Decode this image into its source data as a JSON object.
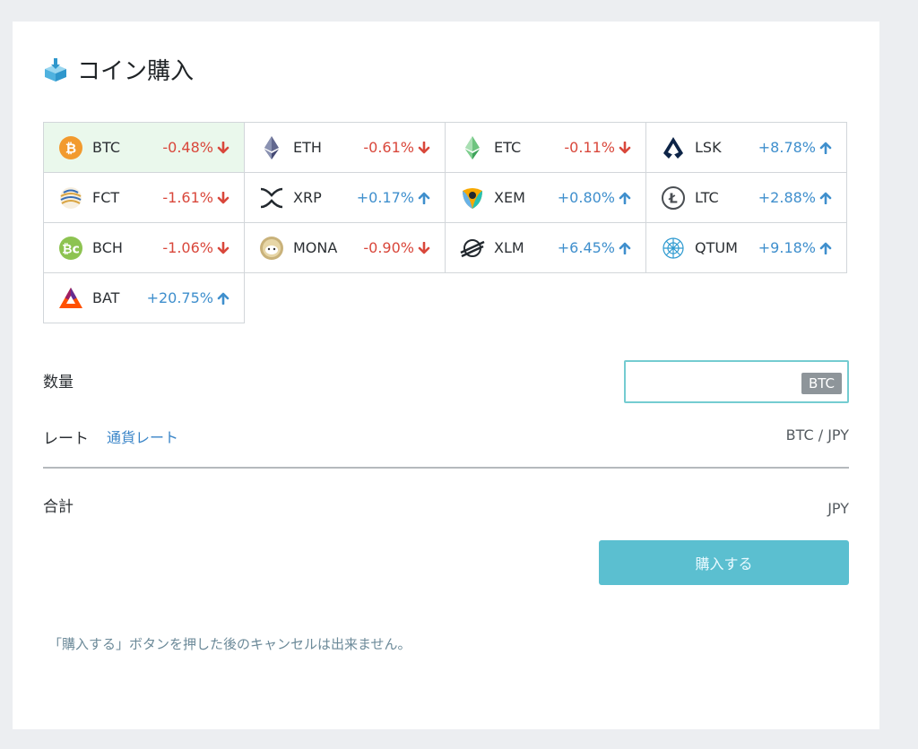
{
  "page": {
    "title": "コイン購入"
  },
  "coins": [
    [
      {
        "symbol": "BTC",
        "change": "-0.48%",
        "direction": "down",
        "icon": "bitcoin-icon",
        "selected": true
      },
      {
        "symbol": "ETH",
        "change": "-0.61%",
        "direction": "down",
        "icon": "ethereum-icon"
      },
      {
        "symbol": "ETC",
        "change": "-0.11%",
        "direction": "down",
        "icon": "ethereum-classic-icon"
      },
      {
        "symbol": "LSK",
        "change": "+8.78%",
        "direction": "up",
        "icon": "lisk-icon"
      }
    ],
    [
      {
        "symbol": "FCT",
        "change": "-1.61%",
        "direction": "down",
        "icon": "factom-icon"
      },
      {
        "symbol": "XRP",
        "change": "+0.17%",
        "direction": "up",
        "icon": "ripple-icon"
      },
      {
        "symbol": "XEM",
        "change": "+0.80%",
        "direction": "up",
        "icon": "nem-icon"
      },
      {
        "symbol": "LTC",
        "change": "+2.88%",
        "direction": "up",
        "icon": "litecoin-icon"
      }
    ],
    [
      {
        "symbol": "BCH",
        "change": "-1.06%",
        "direction": "down",
        "icon": "bitcoin-cash-icon"
      },
      {
        "symbol": "MONA",
        "change": "-0.90%",
        "direction": "down",
        "icon": "monacoin-icon"
      },
      {
        "symbol": "XLM",
        "change": "+6.45%",
        "direction": "up",
        "icon": "stellar-icon"
      },
      {
        "symbol": "QTUM",
        "change": "+9.18%",
        "direction": "up",
        "icon": "qtum-icon"
      }
    ],
    [
      {
        "symbol": "BAT",
        "change": "+20.75%",
        "direction": "up",
        "icon": "bat-icon"
      }
    ]
  ],
  "form": {
    "quantity_label": "数量",
    "quantity_value": "",
    "quantity_unit": "BTC",
    "rate_label": "レート",
    "rate_link": "通貨レート",
    "rate_pair": "BTC / JPY",
    "total_label": "合計",
    "total_currency": "JPY",
    "buy_button": "購入する",
    "notice": "「購入する」ボタンを押した後のキャンセルは出来ません。"
  },
  "colors": {
    "down": "#d9473b",
    "up": "#3f8fcd",
    "accent": "#5bbfd0",
    "selected_bg": "#eaf8ec"
  }
}
